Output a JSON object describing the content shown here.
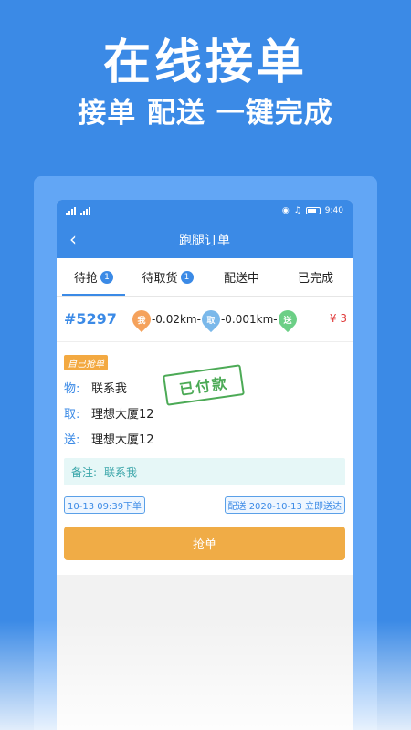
{
  "hero": {
    "title": "在线接单",
    "subtitle": "接单 配送 一键完成"
  },
  "statusbar": {
    "time": "9:40"
  },
  "navbar": {
    "back_icon": "chevron-left-icon",
    "title": "跑腿订单"
  },
  "tabs": [
    {
      "label": "待抢",
      "badge": "1"
    },
    {
      "label": "待取货",
      "badge": "1"
    },
    {
      "label": "配送中"
    },
    {
      "label": "已完成"
    }
  ],
  "order": {
    "number": "#5297",
    "pins": {
      "me": "我",
      "pickup": "取",
      "deliver": "送"
    },
    "dist1": "-0.02km-",
    "dist2": "-0.001km-",
    "price": "¥ 3",
    "self_tag": "自己抢单",
    "rows": [
      {
        "key": "物:",
        "value": "联系我"
      },
      {
        "key": "取:",
        "value": "理想大厦12"
      },
      {
        "key": "送:",
        "value": "理想大厦12"
      }
    ],
    "stamp": "已付款",
    "remark_key": "备注:",
    "remark_value": "联系我",
    "order_time": "10-13 09:39下单",
    "delivery_time": "配送 2020-10-13 立即送达",
    "grab_label": "抢单"
  },
  "colors": {
    "primary": "#3b8ae6",
    "accent_orange": "#f0ac46",
    "price_red": "#e03c3c",
    "stamp_green": "#4caa56"
  }
}
